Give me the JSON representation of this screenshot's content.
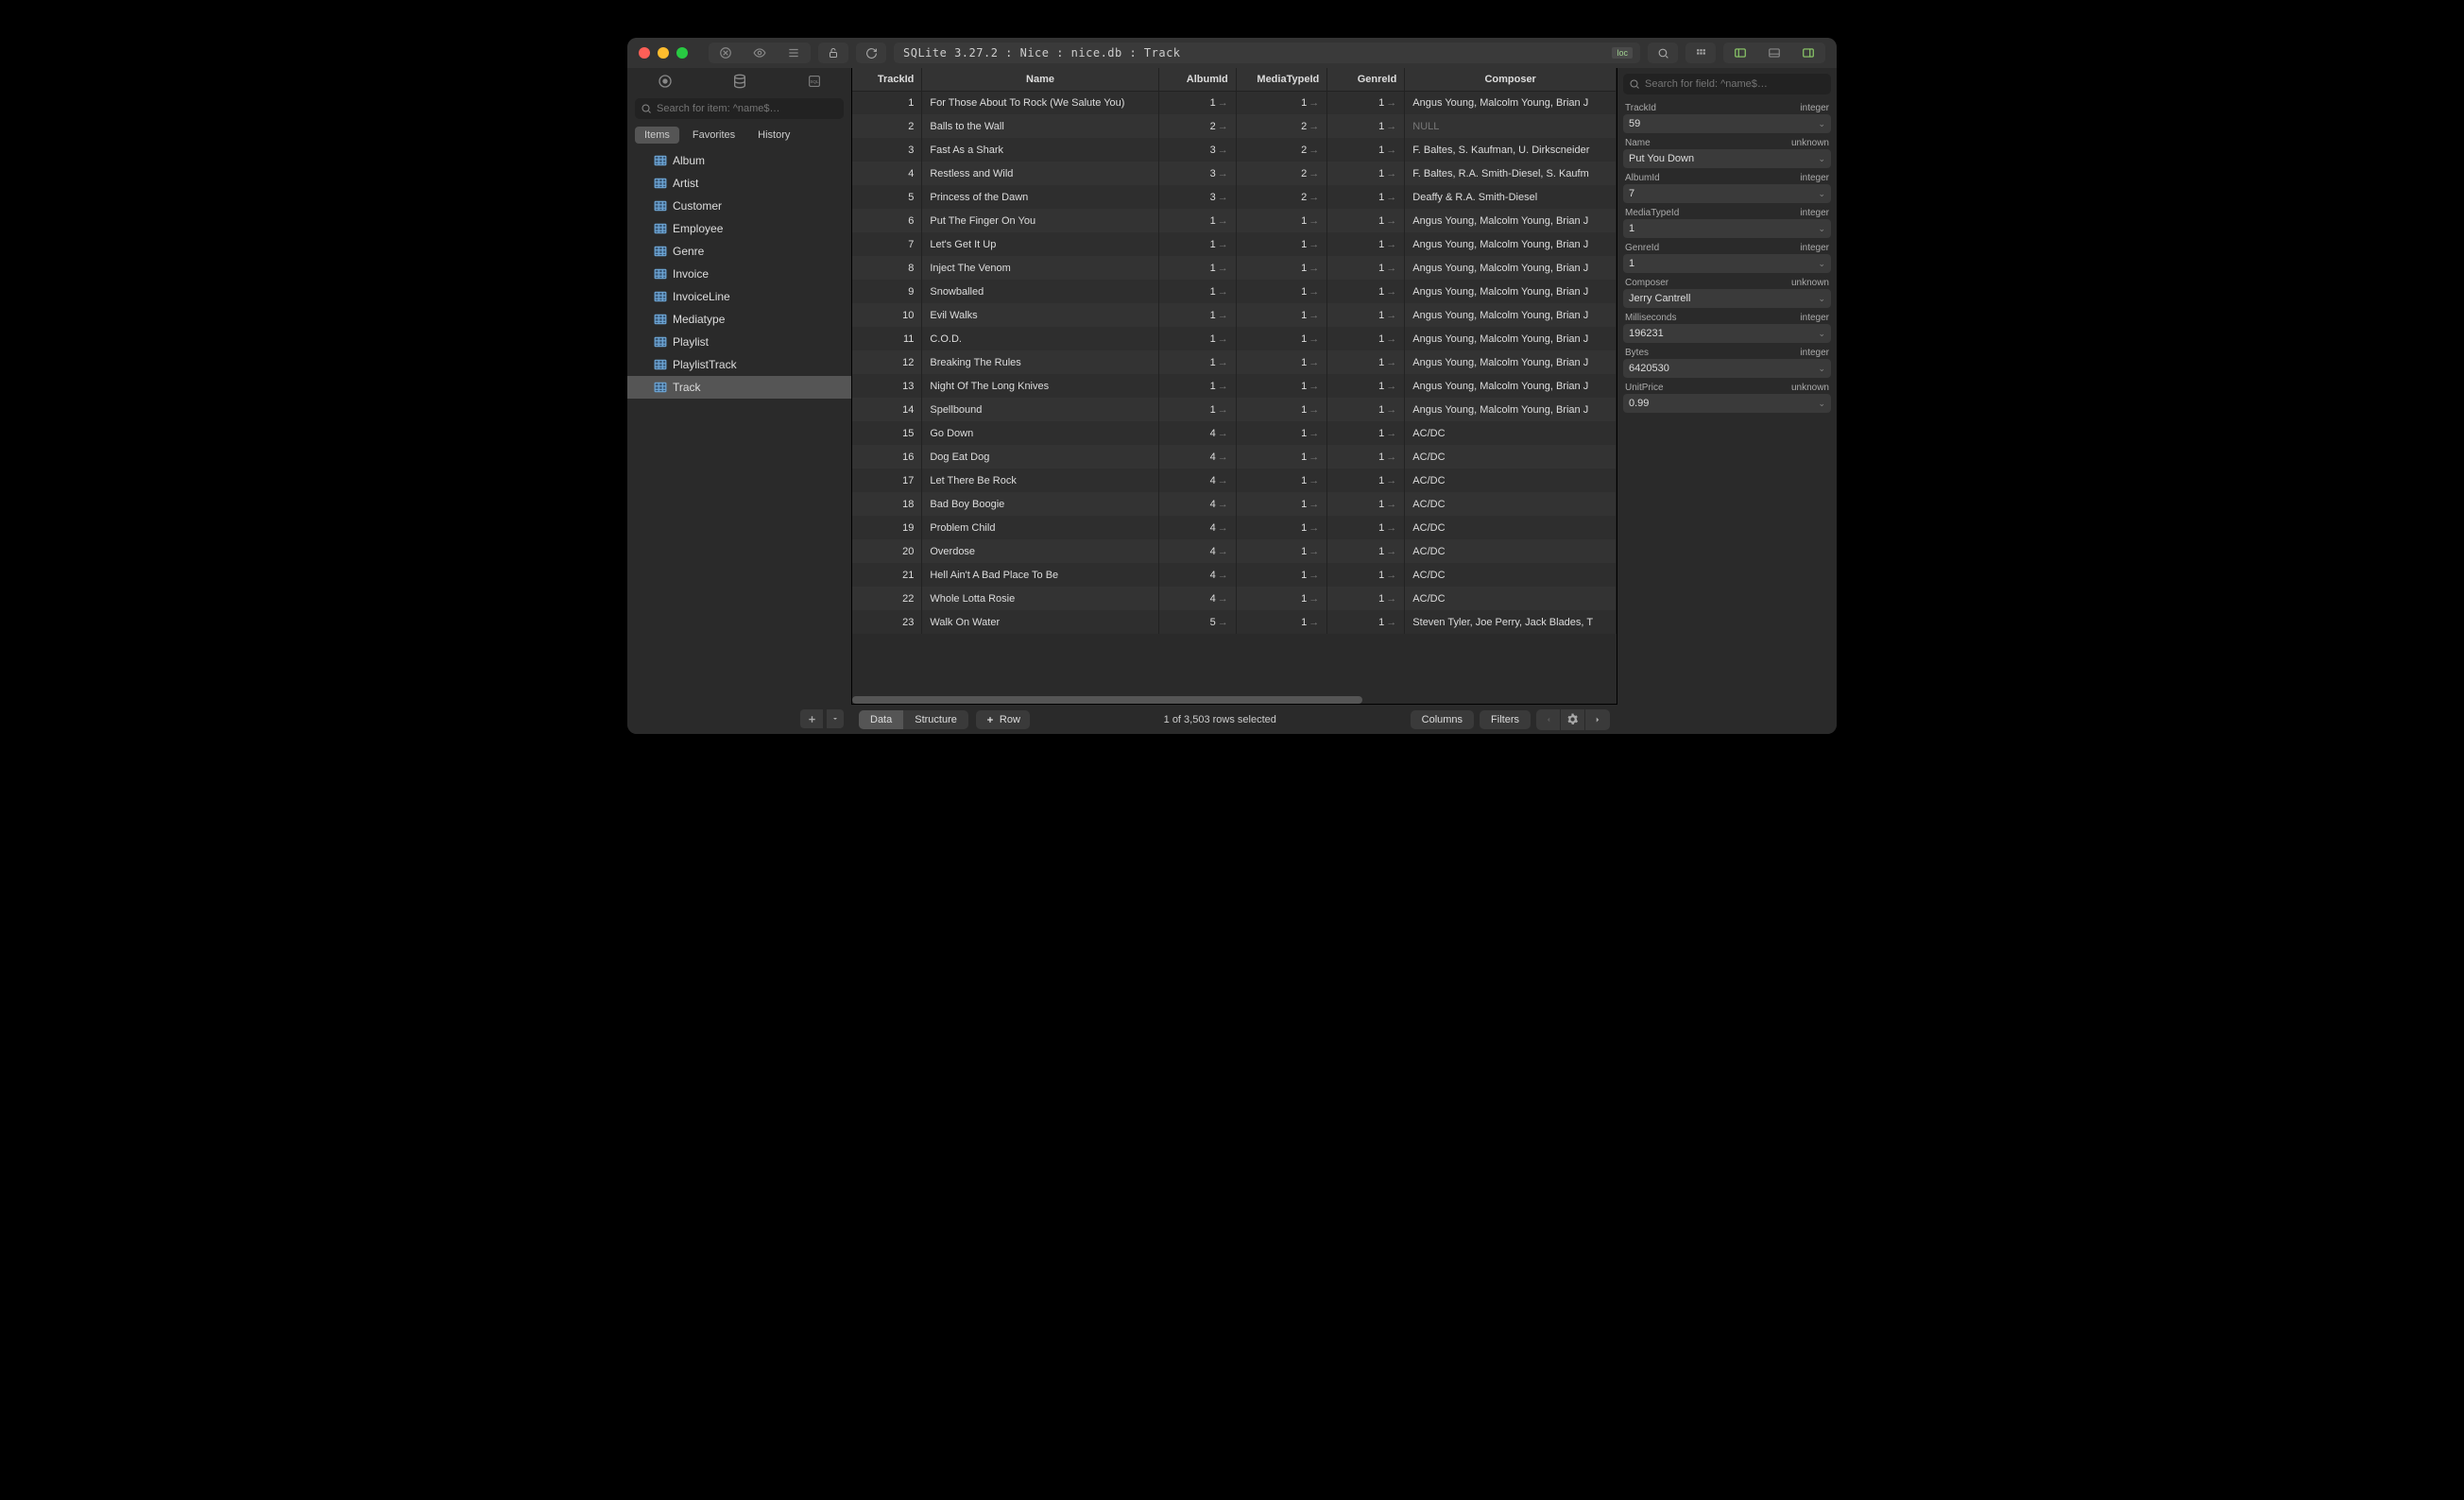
{
  "breadcrumb": "SQLite 3.27.2 : Nice : nice.db : Track",
  "loc_badge": "loc",
  "sidebar": {
    "search_placeholder": "Search for item: ^name$…",
    "sub_tabs": [
      "Items",
      "Favorites",
      "History"
    ],
    "items": [
      {
        "label": "Album"
      },
      {
        "label": "Artist"
      },
      {
        "label": "Customer"
      },
      {
        "label": "Employee"
      },
      {
        "label": "Genre"
      },
      {
        "label": "Invoice"
      },
      {
        "label": "InvoiceLine"
      },
      {
        "label": "Mediatype"
      },
      {
        "label": "Playlist"
      },
      {
        "label": "PlaylistTrack"
      },
      {
        "label": "Track"
      }
    ],
    "selected_index": 10
  },
  "table": {
    "columns": [
      "TrackId",
      "Name",
      "AlbumId",
      "MediaTypeId",
      "GenreId",
      "Composer"
    ],
    "rows": [
      {
        "TrackId": "1",
        "Name": "For Those About To Rock (We Salute You)",
        "AlbumId": "1",
        "MediaTypeId": "1",
        "GenreId": "1",
        "Composer": "Angus Young, Malcolm Young, Brian J"
      },
      {
        "TrackId": "2",
        "Name": "Balls to the Wall",
        "AlbumId": "2",
        "MediaTypeId": "2",
        "GenreId": "1",
        "Composer": null
      },
      {
        "TrackId": "3",
        "Name": "Fast As a Shark",
        "AlbumId": "3",
        "MediaTypeId": "2",
        "GenreId": "1",
        "Composer": "F. Baltes, S. Kaufman, U. Dirkscneider"
      },
      {
        "TrackId": "4",
        "Name": "Restless and Wild",
        "AlbumId": "3",
        "MediaTypeId": "2",
        "GenreId": "1",
        "Composer": "F. Baltes, R.A. Smith-Diesel, S. Kaufm"
      },
      {
        "TrackId": "5",
        "Name": "Princess of the Dawn",
        "AlbumId": "3",
        "MediaTypeId": "2",
        "GenreId": "1",
        "Composer": "Deaffy & R.A. Smith-Diesel"
      },
      {
        "TrackId": "6",
        "Name": "Put The Finger On You",
        "AlbumId": "1",
        "MediaTypeId": "1",
        "GenreId": "1",
        "Composer": "Angus Young, Malcolm Young, Brian J"
      },
      {
        "TrackId": "7",
        "Name": "Let's Get It Up",
        "AlbumId": "1",
        "MediaTypeId": "1",
        "GenreId": "1",
        "Composer": "Angus Young, Malcolm Young, Brian J"
      },
      {
        "TrackId": "8",
        "Name": "Inject The Venom",
        "AlbumId": "1",
        "MediaTypeId": "1",
        "GenreId": "1",
        "Composer": "Angus Young, Malcolm Young, Brian J"
      },
      {
        "TrackId": "9",
        "Name": "Snowballed",
        "AlbumId": "1",
        "MediaTypeId": "1",
        "GenreId": "1",
        "Composer": "Angus Young, Malcolm Young, Brian J"
      },
      {
        "TrackId": "10",
        "Name": "Evil Walks",
        "AlbumId": "1",
        "MediaTypeId": "1",
        "GenreId": "1",
        "Composer": "Angus Young, Malcolm Young, Brian J"
      },
      {
        "TrackId": "11",
        "Name": "C.O.D.",
        "AlbumId": "1",
        "MediaTypeId": "1",
        "GenreId": "1",
        "Composer": "Angus Young, Malcolm Young, Brian J"
      },
      {
        "TrackId": "12",
        "Name": "Breaking The Rules",
        "AlbumId": "1",
        "MediaTypeId": "1",
        "GenreId": "1",
        "Composer": "Angus Young, Malcolm Young, Brian J"
      },
      {
        "TrackId": "13",
        "Name": "Night Of The Long Knives",
        "AlbumId": "1",
        "MediaTypeId": "1",
        "GenreId": "1",
        "Composer": "Angus Young, Malcolm Young, Brian J"
      },
      {
        "TrackId": "14",
        "Name": "Spellbound",
        "AlbumId": "1",
        "MediaTypeId": "1",
        "GenreId": "1",
        "Composer": "Angus Young, Malcolm Young, Brian J"
      },
      {
        "TrackId": "15",
        "Name": "Go Down",
        "AlbumId": "4",
        "MediaTypeId": "1",
        "GenreId": "1",
        "Composer": "AC/DC"
      },
      {
        "TrackId": "16",
        "Name": "Dog Eat Dog",
        "AlbumId": "4",
        "MediaTypeId": "1",
        "GenreId": "1",
        "Composer": "AC/DC"
      },
      {
        "TrackId": "17",
        "Name": "Let There Be Rock",
        "AlbumId": "4",
        "MediaTypeId": "1",
        "GenreId": "1",
        "Composer": "AC/DC"
      },
      {
        "TrackId": "18",
        "Name": "Bad Boy Boogie",
        "AlbumId": "4",
        "MediaTypeId": "1",
        "GenreId": "1",
        "Composer": "AC/DC"
      },
      {
        "TrackId": "19",
        "Name": "Problem Child",
        "AlbumId": "4",
        "MediaTypeId": "1",
        "GenreId": "1",
        "Composer": "AC/DC"
      },
      {
        "TrackId": "20",
        "Name": "Overdose",
        "AlbumId": "4",
        "MediaTypeId": "1",
        "GenreId": "1",
        "Composer": "AC/DC"
      },
      {
        "TrackId": "21",
        "Name": "Hell Ain't A Bad Place To Be",
        "AlbumId": "4",
        "MediaTypeId": "1",
        "GenreId": "1",
        "Composer": "AC/DC"
      },
      {
        "TrackId": "22",
        "Name": "Whole Lotta Rosie",
        "AlbumId": "4",
        "MediaTypeId": "1",
        "GenreId": "1",
        "Composer": "AC/DC"
      },
      {
        "TrackId": "23",
        "Name": "Walk On Water",
        "AlbumId": "5",
        "MediaTypeId": "1",
        "GenreId": "1",
        "Composer": "Steven Tyler, Joe Perry, Jack Blades, T"
      }
    ]
  },
  "footer": {
    "seg": [
      "Data",
      "Structure"
    ],
    "row_btn": "Row",
    "status": "1 of 3,503 rows selected",
    "columns_btn": "Columns",
    "filters_btn": "Filters"
  },
  "inspector": {
    "search_placeholder": "Search for field: ^name$…",
    "fields": [
      {
        "name": "TrackId",
        "type": "integer",
        "value": "59"
      },
      {
        "name": "Name",
        "type": "unknown",
        "value": "Put You Down"
      },
      {
        "name": "AlbumId",
        "type": "integer",
        "value": "7"
      },
      {
        "name": "MediaTypeId",
        "type": "integer",
        "value": "1"
      },
      {
        "name": "GenreId",
        "type": "integer",
        "value": "1"
      },
      {
        "name": "Composer",
        "type": "unknown",
        "value": "Jerry Cantrell"
      },
      {
        "name": "Milliseconds",
        "type": "integer",
        "value": "196231"
      },
      {
        "name": "Bytes",
        "type": "integer",
        "value": "6420530"
      },
      {
        "name": "UnitPrice",
        "type": "unknown",
        "value": "0.99"
      }
    ]
  },
  "null_label": "NULL"
}
